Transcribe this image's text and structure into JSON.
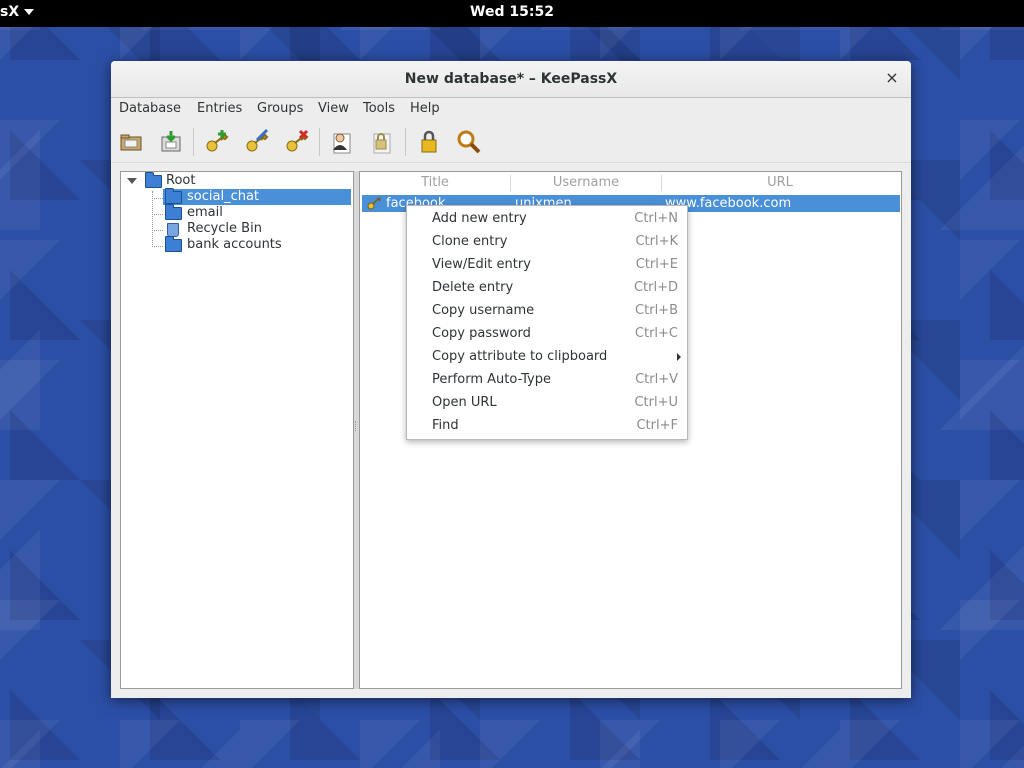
{
  "topbar": {
    "app_menu_label": "sX",
    "clock": "Wed 15:52"
  },
  "window": {
    "title": "New database* – KeePassX",
    "close_label": "×"
  },
  "menubar": {
    "database": "Database",
    "entries": "Entries",
    "groups": "Groups",
    "view": "View",
    "tools": "Tools",
    "help": "Help"
  },
  "toolbar": {
    "icons": [
      "open-database-icon",
      "save-database-icon",
      "add-entry-icon",
      "edit-entry-icon",
      "delete-entry-icon",
      "copy-username-icon",
      "copy-password-icon",
      "lock-database-icon",
      "search-icon"
    ]
  },
  "tree": {
    "root": "Root",
    "groups": [
      "social_chat",
      "email",
      "Recycle Bin",
      "bank accounts"
    ],
    "selected": "social_chat"
  },
  "entries": {
    "columns": [
      "Title",
      "Username",
      "URL"
    ],
    "rows": [
      {
        "title": "facebook",
        "username": "unixmen",
        "url": "www.facebook.com"
      }
    ]
  },
  "context_menu": {
    "items": [
      {
        "label": "Add new entry",
        "shortcut": "Ctrl+N"
      },
      {
        "label": "Clone entry",
        "shortcut": "Ctrl+K"
      },
      {
        "label": "View/Edit entry",
        "shortcut": "Ctrl+E"
      },
      {
        "label": "Delete entry",
        "shortcut": "Ctrl+D"
      },
      {
        "label": "Copy username",
        "shortcut": "Ctrl+B"
      },
      {
        "label": "Copy password",
        "shortcut": "Ctrl+C"
      },
      {
        "label": "Copy attribute to clipboard",
        "shortcut": ""
      },
      {
        "label": "Perform Auto-Type",
        "shortcut": "Ctrl+V"
      },
      {
        "label": "Open URL",
        "shortcut": "Ctrl+U"
      },
      {
        "label": "Find",
        "shortcut": "Ctrl+F"
      }
    ]
  },
  "colors": {
    "selection": "#4a90d9",
    "desktop": "#2c4fa6",
    "topbar": "#000000"
  }
}
